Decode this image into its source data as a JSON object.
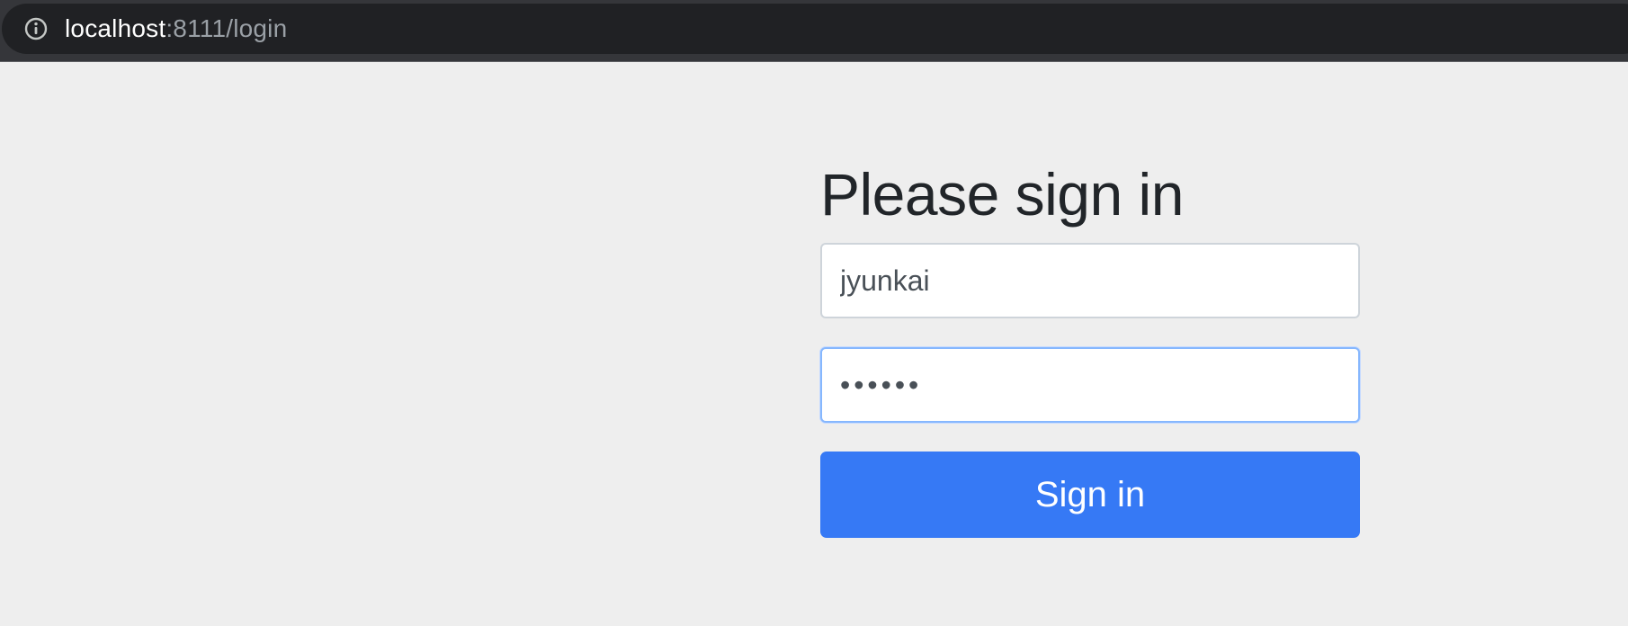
{
  "browser": {
    "url_host": "localhost",
    "url_rest": ":8111/login",
    "info_icon": "info-circle-icon"
  },
  "form": {
    "heading": "Please sign in",
    "username_value": "jyunkai",
    "password_value": "••••••",
    "submit_label": "Sign in"
  },
  "colors": {
    "primary_button": "#3679f5",
    "page_background": "#eeeeee",
    "focus_border": "#86b7fe"
  }
}
